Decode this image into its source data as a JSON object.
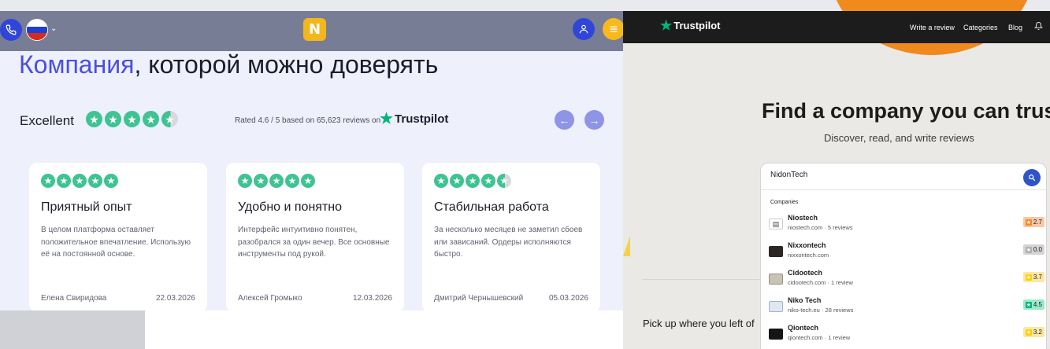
{
  "left": {
    "nav": {
      "phone_icon": "phone-icon",
      "flag": "russia-flag",
      "logo_letter": "N",
      "user_icon": "user-icon",
      "menu_icon": "menu-icon"
    },
    "headline": {
      "accent": "Компания",
      "rest": ", которой можно доверять"
    },
    "rating": {
      "label": "Excellent",
      "rated_text": "Rated 4.6 / 5 based on 65,623 reviews on",
      "brand": "Trustpilot",
      "stars_value": 4.5
    },
    "reviews": [
      {
        "stars": 5,
        "title": "Приятный опыт",
        "body": "В целом платформа оставляет положительное впечатление. Использую её на постоянной основе.",
        "author": "Елена Свиридова",
        "date": "22.03.2026"
      },
      {
        "stars": 5,
        "title": "Удобно и понятно",
        "body": "Интерфейс интуитивно понятен, разобрался за один вечер. Все основные инструменты под рукой.",
        "author": "Алексей Громыко",
        "date": "12.03.2026"
      },
      {
        "stars": 4.5,
        "title": "Стабильная работа",
        "body": "За несколько месяцев не заметил сбоев или зависаний. Ордеры исполняются быстро.",
        "author": "Дмитрий Чернышевский",
        "date": "05.03.2026"
      }
    ]
  },
  "right": {
    "nav": {
      "brand": "Trustpilot",
      "links": [
        "Write a review",
        "Categories",
        "Blog"
      ]
    },
    "hero": {
      "title": "Find a company you can trust",
      "subtitle": "Discover, read, and write reviews"
    },
    "search": {
      "value": "NidonTech",
      "section_label": "Companies",
      "results": [
        {
          "name": "Niostech",
          "domain": "niostech.com",
          "reviews": "5 reviews",
          "rating": "2.7",
          "badge_color": "#f6c9a9",
          "star_color": "#ff8622",
          "thumb_color": "#ffffff"
        },
        {
          "name": "Nixxontech",
          "domain": "nixxontech.com",
          "reviews": "",
          "rating": "0.0",
          "badge_color": "#d3d3d3",
          "star_color": "#b0b0b0",
          "thumb_color": "#2b2620"
        },
        {
          "name": "Cidootech",
          "domain": "cidootech.com",
          "reviews": "1 review",
          "rating": "3.7",
          "badge_color": "#fbe7a5",
          "star_color": "#ffce00",
          "thumb_color": "#c9c2b6"
        },
        {
          "name": "Niko Tech",
          "domain": "niko-tech.eu",
          "reviews": "28 reviews",
          "rating": "4.5",
          "badge_color": "#9ce9c8",
          "star_color": "#00b67a",
          "thumb_color": "#dfe8f2"
        },
        {
          "name": "Qiontech",
          "domain": "qiontech.com",
          "reviews": "1 review",
          "rating": "3.2",
          "badge_color": "#fbe7a5",
          "star_color": "#ffce00",
          "thumb_color": "#151515"
        }
      ]
    },
    "pickup": "Pick up where you left of"
  },
  "colors": {
    "accent": "#4a4fe0",
    "trustpilot_green": "#00b67a",
    "nav_blue": "#2f46d8",
    "logo_yellow": "#f3b61d"
  }
}
